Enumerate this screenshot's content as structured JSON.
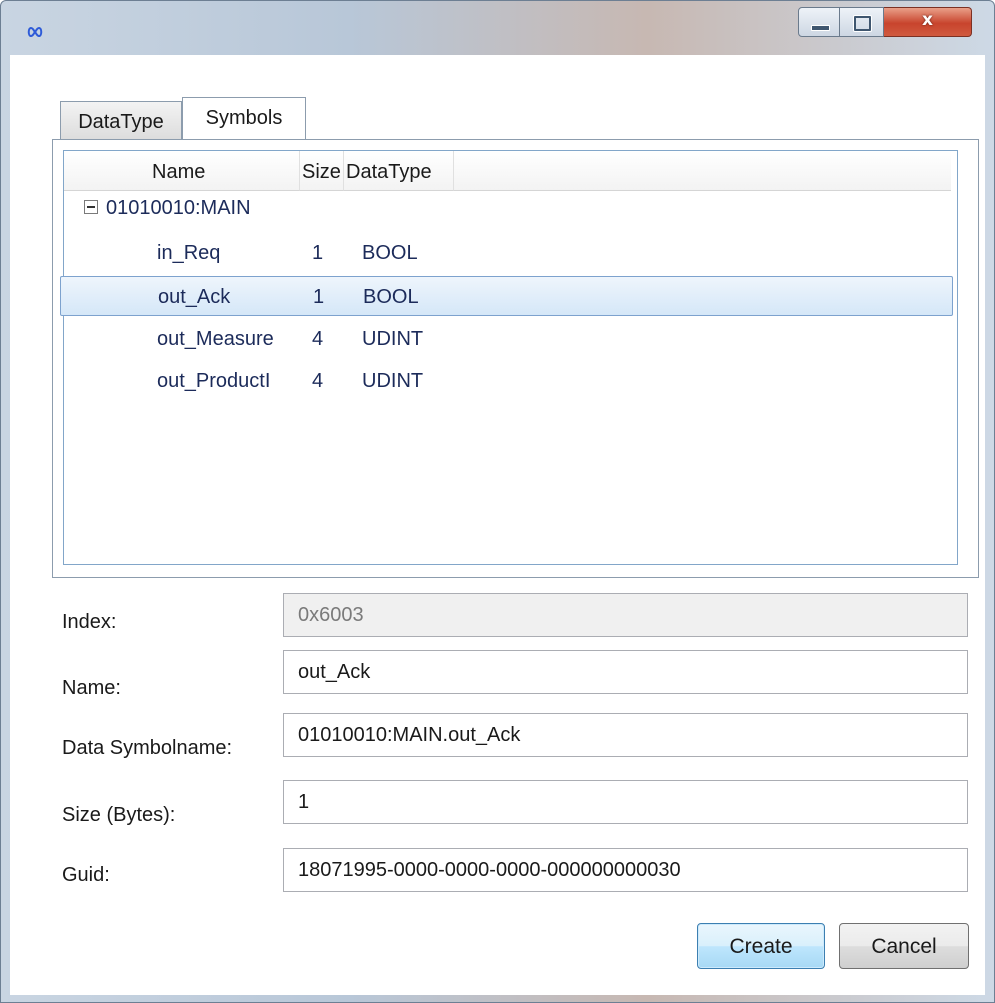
{
  "window": {
    "title": "",
    "controls": {
      "minimize": "minimize",
      "maximize": "maximize",
      "close": "x"
    }
  },
  "tabs": [
    {
      "label": "DataType"
    },
    {
      "label": "Symbols"
    }
  ],
  "tree": {
    "columns": {
      "name": "Name",
      "size": "Size",
      "datatype": "DataType"
    },
    "root": "01010010:MAIN",
    "rows": [
      {
        "name": "in_Req",
        "size": "1",
        "datatype": "BOOL"
      },
      {
        "name": "out_Ack",
        "size": "1",
        "datatype": "BOOL"
      },
      {
        "name": "out_Measure",
        "size": "4",
        "datatype": "UDINT"
      },
      {
        "name": "out_ProductI",
        "size": "4",
        "datatype": "UDINT"
      }
    ],
    "selected_index": 1
  },
  "form": {
    "index_label": "Index:",
    "index_value": "0x6003",
    "name_label": "Name:",
    "name_value": "out_Ack",
    "symbol_label": "Data Symbolname:",
    "symbol_value": "01010010:MAIN.out_Ack",
    "size_label": "Size (Bytes):",
    "size_value": "1",
    "guid_label": "Guid:",
    "guid_value": "18071995-0000-0000-0000-000000000030"
  },
  "buttons": {
    "create": "Create",
    "cancel": "Cancel"
  },
  "colors": {
    "selection": "#d5e7f8",
    "create_button": "#bee6fd",
    "close_button": "#c8442d"
  }
}
